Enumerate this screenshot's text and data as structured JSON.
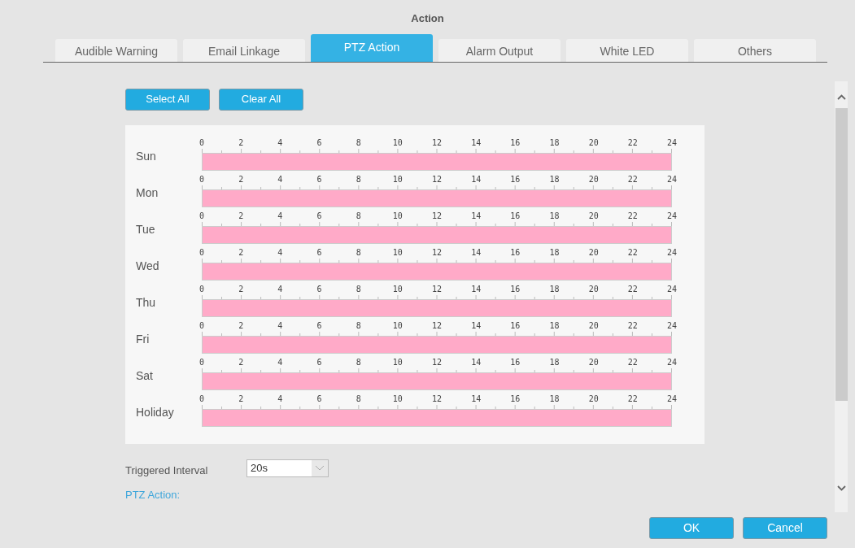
{
  "window": {
    "title": "Action"
  },
  "tabs": [
    {
      "label": "Audible Warning",
      "selected": false
    },
    {
      "label": "Email Linkage",
      "selected": false
    },
    {
      "label": "PTZ Action",
      "selected": true
    },
    {
      "label": "Alarm Output",
      "selected": false
    },
    {
      "label": "White LED",
      "selected": false
    },
    {
      "label": "Others",
      "selected": false
    }
  ],
  "schedule_buttons": [
    "Select All",
    "Clear All"
  ],
  "schedule": [
    {
      "day": "Sun",
      "hours": [
        "0",
        "2",
        "4",
        "6",
        "8",
        "10",
        "12",
        "14",
        "16",
        "18",
        "20",
        "22",
        "24"
      ],
      "scheduled": true
    },
    {
      "day": "Mon",
      "hours": [
        "0",
        "2",
        "4",
        "6",
        "8",
        "10",
        "12",
        "14",
        "16",
        "18",
        "20",
        "22",
        "24"
      ],
      "scheduled": true
    },
    {
      "day": "Tue",
      "hours": [
        "0",
        "2",
        "4",
        "6",
        "8",
        "10",
        "12",
        "14",
        "16",
        "18",
        "20",
        "22",
        "24"
      ],
      "scheduled": true
    },
    {
      "day": "Wed",
      "hours": [
        "0",
        "2",
        "4",
        "6",
        "8",
        "10",
        "12",
        "14",
        "16",
        "18",
        "20",
        "22",
        "24"
      ],
      "scheduled": true
    },
    {
      "day": "Thu",
      "hours": [
        "0",
        "2",
        "4",
        "6",
        "8",
        "10",
        "12",
        "14",
        "16",
        "18",
        "20",
        "22",
        "24"
      ],
      "scheduled": true
    },
    {
      "day": "Fri",
      "hours": [
        "0",
        "2",
        "4",
        "6",
        "8",
        "10",
        "12",
        "14",
        "16",
        "18",
        "20",
        "22",
        "24"
      ],
      "scheduled": true
    },
    {
      "day": "Sat",
      "hours": [
        "0",
        "2",
        "4",
        "6",
        "8",
        "10",
        "12",
        "14",
        "16",
        "18",
        "20",
        "22",
        "24"
      ],
      "scheduled": true
    },
    {
      "day": "Holiday",
      "hours": [
        "0",
        "2",
        "4",
        "6",
        "8",
        "10",
        "12",
        "14",
        "16",
        "18",
        "20",
        "22",
        "24"
      ],
      "scheduled": true
    }
  ],
  "triggered_interval": {
    "label": "Triggered Interval",
    "value": "20s"
  },
  "section_heading": "PTZ Action:",
  "buttons": [
    "OK",
    "Cancel"
  ]
}
